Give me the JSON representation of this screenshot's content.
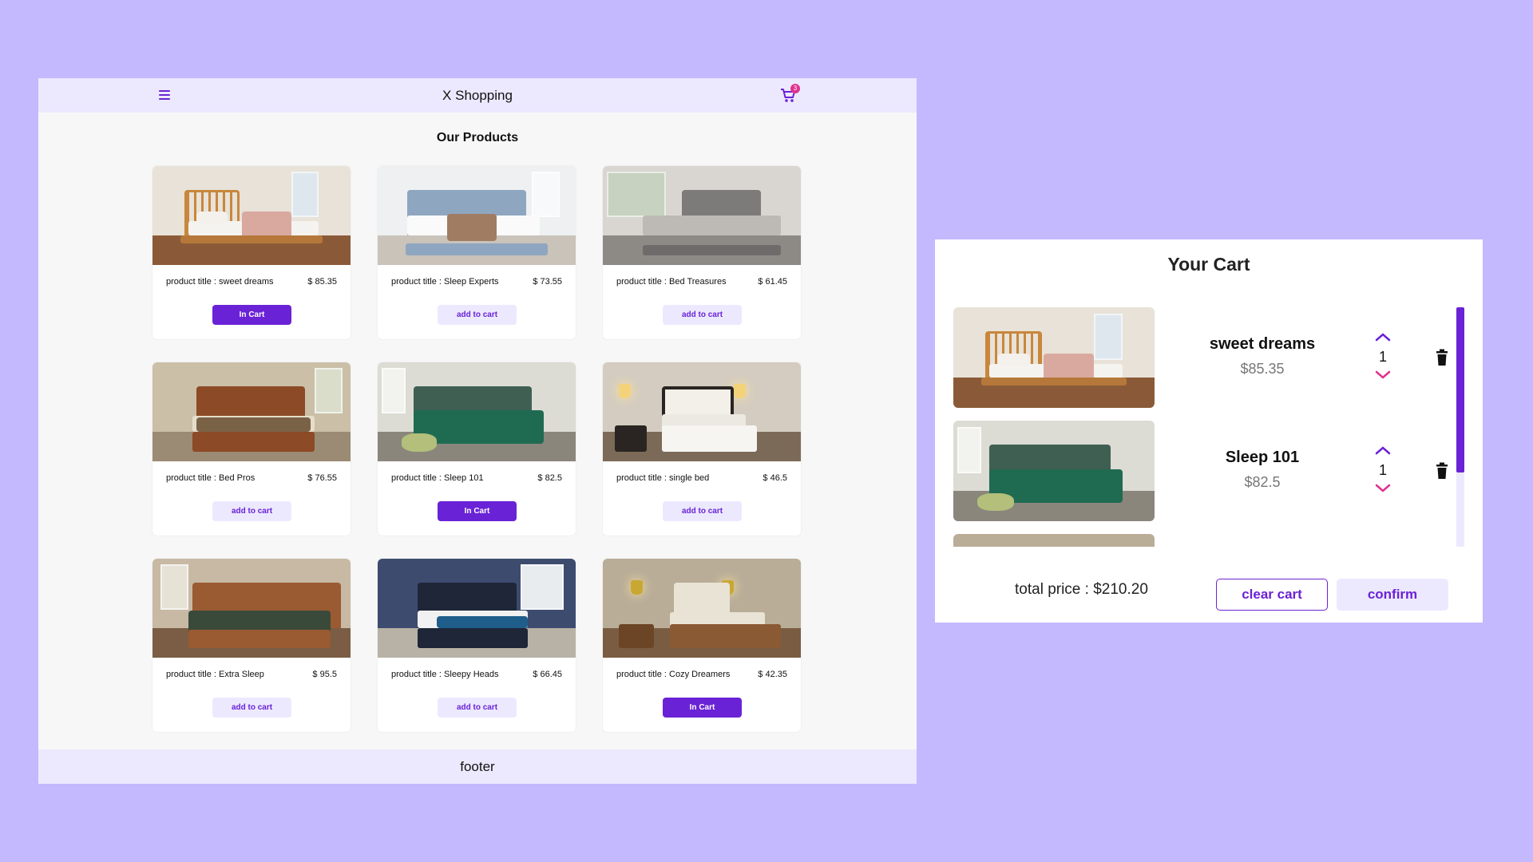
{
  "shop": {
    "title": "X Shopping",
    "cart_count": "3",
    "products_heading": "Our Products",
    "footer": "footer"
  },
  "products": [
    {
      "title": "product title : sweet dreams",
      "price": "$ 85.35",
      "button": "In Cart"
    },
    {
      "title": "product title : Sleep Experts",
      "price": "$ 73.55",
      "button": "add to cart"
    },
    {
      "title": "product title : Bed Treasures",
      "price": "$ 61.45",
      "button": "add to cart"
    },
    {
      "title": "product title : Bed Pros",
      "price": "$ 76.55",
      "button": "add to cart"
    },
    {
      "title": "product title : Sleep 101",
      "price": "$ 82.5",
      "button": "In Cart"
    },
    {
      "title": "product title : single bed",
      "price": "$ 46.5",
      "button": "add to cart"
    },
    {
      "title": "product title : Extra Sleep",
      "price": "$ 95.5",
      "button": "add to cart"
    },
    {
      "title": "product title : Sleepy Heads",
      "price": "$ 66.45",
      "button": "add to cart"
    },
    {
      "title": "product title : Cozy Dreamers",
      "price": "$ 42.35",
      "button": "In Cart"
    }
  ],
  "cart": {
    "title": "Your Cart",
    "items": [
      {
        "name": "sweet dreams",
        "price": "$85.35",
        "qty": "1"
      },
      {
        "name": "Sleep 101",
        "price": "$82.5",
        "qty": "1"
      }
    ],
    "total": "total price : $210.20",
    "clear_label": "clear cart",
    "confirm_label": "confirm"
  },
  "colors": {
    "background": "#c4b8fe",
    "accent": "#6a22d6",
    "accent_light": "#ece9ff",
    "badge": "#e0318f"
  }
}
